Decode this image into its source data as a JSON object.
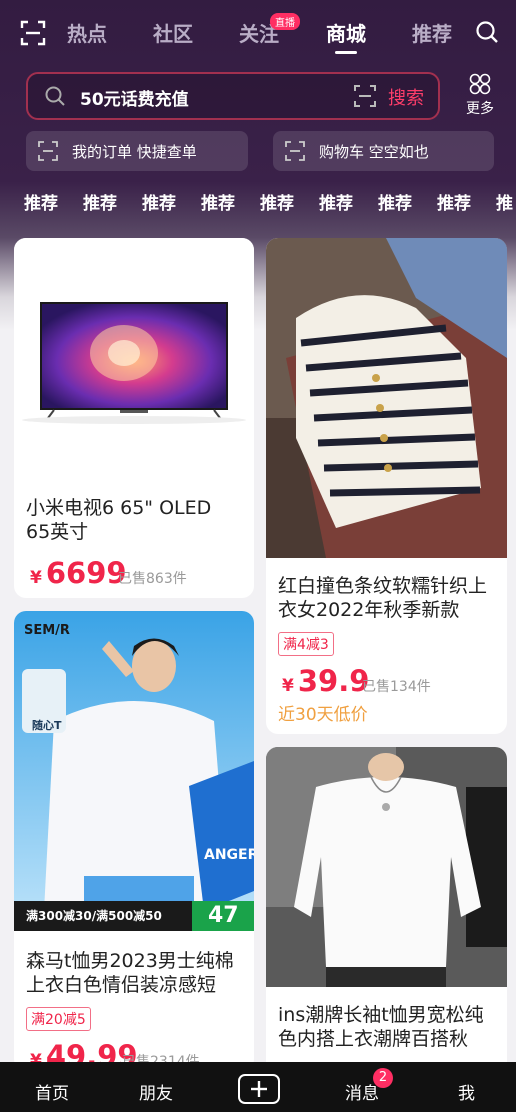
{
  "topnav": {
    "tabs": [
      {
        "label": "热点"
      },
      {
        "label": "社区"
      },
      {
        "label": "关注"
      },
      {
        "label": "商城"
      },
      {
        "label": "推荐"
      }
    ],
    "live_badge": "直播",
    "active_tab": "商城"
  },
  "search": {
    "placeholder": "50元话费充值",
    "button": "搜索",
    "more": "更多"
  },
  "chips": [
    {
      "label": "我的订单 快捷查单"
    },
    {
      "label": "购物车 空空如也"
    }
  ],
  "categories": [
    "推荐",
    "推荐",
    "推荐",
    "推荐",
    "推荐",
    "推荐",
    "推荐",
    "推荐",
    "推"
  ],
  "products": [
    {
      "title": "小米电视6 65\" OLED 65英寸",
      "currency": "¥",
      "price": "6699",
      "sold": "已售863件"
    },
    {
      "title": "红白撞色条纹软糯针织上衣女2022年秋季新款",
      "promo": "满4减3",
      "currency": "¥",
      "price": "39.9",
      "sold": "已售134件",
      "note": "近30天低价"
    },
    {
      "title": "森马t恤男2023男士纯棉上衣白色情侣装凉感短",
      "promo": "满20减5",
      "currency": "¥",
      "price": "49.99",
      "sold": "已售2314件",
      "img_text": {
        "brand": "SEM/R",
        "promo_line": "满300减30/满500减50",
        "badge_num": "47",
        "tag": "随心T",
        "board": "ANGEROUS"
      }
    },
    {
      "title": "ins潮牌长袖t恤男宽松纯色内搭上衣潮牌百搭秋"
    }
  ],
  "bottomnav": {
    "items": [
      {
        "label": "首页"
      },
      {
        "label": "朋友"
      },
      {
        "label": "消息"
      },
      {
        "label": "我"
      }
    ],
    "message_badge": "2"
  },
  "colors": {
    "accent": "#f0254a",
    "hero_bg": "#331c41",
    "search_border": "#a2304f",
    "low_price": "#f0a040"
  }
}
